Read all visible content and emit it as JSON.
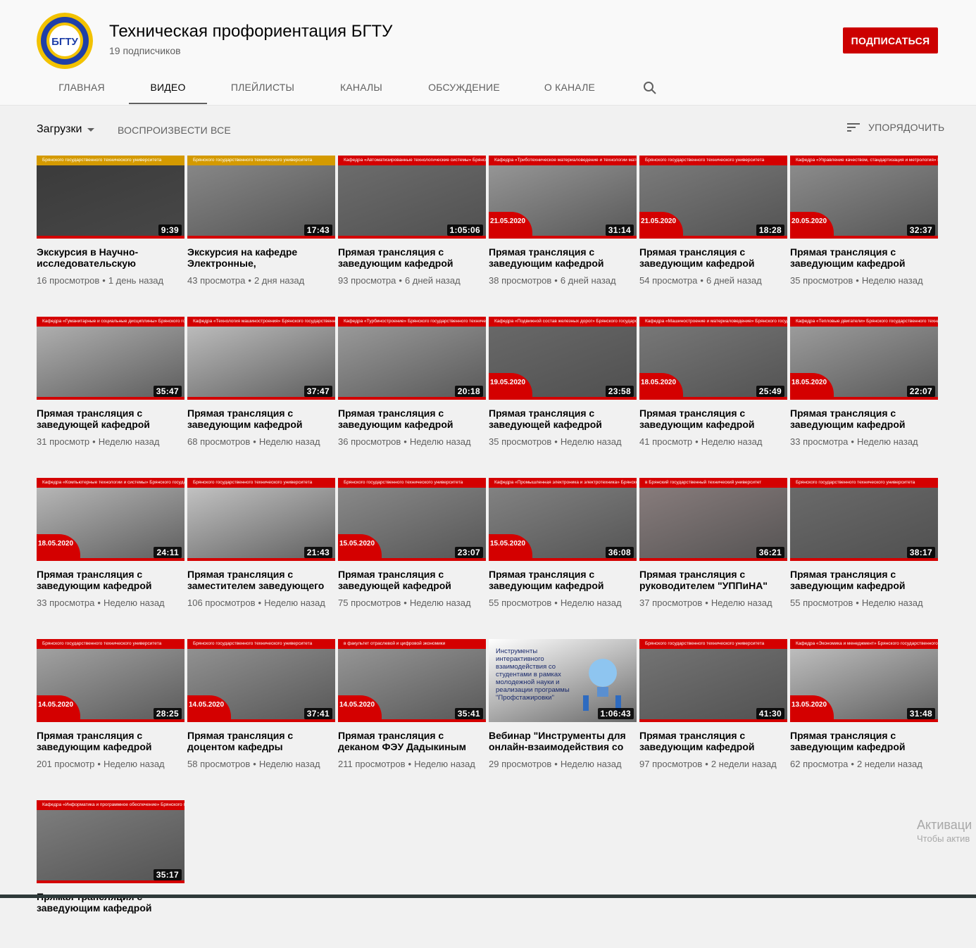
{
  "channel": {
    "title": "Техническая профориентация БГТУ",
    "subscribers": "19 подписчиков",
    "avatar_text": "БГТУ",
    "subscribe_label": "ПОДПИСАТЬСЯ"
  },
  "tabs": [
    {
      "label": "ГЛАВНАЯ"
    },
    {
      "label": "ВИДЕО"
    },
    {
      "label": "ПЛЕЙЛИСТЫ"
    },
    {
      "label": "КАНАЛЫ"
    },
    {
      "label": "ОБСУЖДЕНИЕ"
    },
    {
      "label": "О КАНАЛЕ"
    }
  ],
  "toolbar": {
    "uploads_label": "Загрузки",
    "play_all_label": "ВОСПРОИЗВЕСТИ ВСЕ",
    "sort_label": "УПОРЯДОЧИТЬ"
  },
  "colors": {
    "accent": "#cc0000",
    "text_secondary": "#606060",
    "page_bg": "#f1f1f1"
  },
  "videos": [
    {
      "title": "Экскурсия в Научно-исследовательскую лабораторию",
      "views": "16 просмотров",
      "age": "1 день назад",
      "duration": "9:39",
      "banner": "Брянского государственного технического университета",
      "banner_style": "yellow",
      "date": "",
      "scene": "#3a3a3a"
    },
    {
      "title": "Экскурсия на кафедре Электронные, радиоэлектронные и электротехнические системы",
      "views": "43 просмотра",
      "age": "2 дня назад",
      "duration": "17:43",
      "banner": "Брянского государственного технического университета",
      "banner_style": "yellow",
      "date": "",
      "scene": "#8a8a8a"
    },
    {
      "title": "Прямая трансляция с заведующим кафедрой «Автоматизированные технологические системы»",
      "views": "93 просмотра",
      "age": "6 дней назад",
      "duration": "1:05:06",
      "banner": "Кафедра «Автоматизированные технологические системы» Брянского государственного технического университета",
      "banner_style": "red",
      "date": "",
      "scene": "#6e6e6e"
    },
    {
      "title": "Прямая трансляция с заведующим кафедрой «Триботехническое материаловедение»",
      "views": "38 просмотров",
      "age": "6 дней назад",
      "duration": "31:14",
      "banner": "Кафедра «Триботехническое материаловедение и технологии материалов» Брянского государственного технического университета",
      "banner_style": "red",
      "date": "21.05.2020",
      "scene": "#9a9a9a"
    },
    {
      "title": "Прямая трансляция с заведующим кафедрой «Нефтегазовое дело»",
      "views": "54 просмотра",
      "age": "6 дней назад",
      "duration": "18:28",
      "banner": "Брянского государственного технического университета",
      "banner_style": "red",
      "date": "21.05.2020",
      "scene": "#7d7d7d"
    },
    {
      "title": "Прямая трансляция с заведующим кафедрой «Управление качеством»",
      "views": "35 просмотров",
      "age": "Неделю назад",
      "duration": "32:37",
      "banner": "Кафедра «Управление качеством, стандартизация и метрология» Брянского государственного технического университета",
      "banner_style": "red",
      "date": "20.05.2020",
      "scene": "#8f8f8f"
    },
    {
      "title": "Прямая трансляция с заведующей кафедрой «Гуманитарные и социальные дисциплины»",
      "views": "31 просмотр",
      "age": "Неделю назад",
      "duration": "35:47",
      "banner": "Кафедра «Гуманитарные и социальные дисциплины» Брянского государственного технического университета",
      "banner_style": "red",
      "date": "",
      "scene": "#b5b5b5"
    },
    {
      "title": "Прямая трансляция с заведующим кафедрой «Технология машиностроения»",
      "views": "68 просмотров",
      "age": "Неделю назад",
      "duration": "37:47",
      "banner": "Кафедра «Технология машиностроения» Брянского государственного технического университета",
      "banner_style": "red",
      "date": "",
      "scene": "#c2c2c2"
    },
    {
      "title": "Прямая трансляция с заведующим кафедрой «Турбиностроение»",
      "views": "36 просмотров",
      "age": "Неделю назад",
      "duration": "20:18",
      "banner": "Кафедра «Турбиностроение» Брянского государственного технического университета",
      "banner_style": "red",
      "date": "",
      "scene": "#9e9e9e"
    },
    {
      "title": "Прямая трансляция с заведующей кафедрой «Подвижной состав железных дорог»",
      "views": "35 просмотров",
      "age": "Неделю назад",
      "duration": "23:58",
      "banner": "Кафедра «Подвижной состав железных дорог» Брянского государственного технического университета",
      "banner_style": "red",
      "date": "19.05.2020",
      "scene": "#6a6a6a"
    },
    {
      "title": "Прямая трансляция с заведующим кафедрой «Машиностроение и материаловедение»",
      "views": "41 просмотр",
      "age": "Неделю назад",
      "duration": "25:49",
      "banner": "Кафедра «Машиностроение и материаловедение» Брянского государственного технического университета",
      "banner_style": "red",
      "date": "18.05.2020",
      "scene": "#7a7a7a"
    },
    {
      "title": "Прямая трансляция с заведующим кафедрой «Тепловые двигатели»",
      "views": "33 просмотра",
      "age": "Неделю назад",
      "duration": "22:07",
      "banner": "Кафедра «Тепловые двигатели» Брянского государственного технического университета",
      "banner_style": "red",
      "date": "18.05.2020",
      "scene": "#a0a0a0"
    },
    {
      "title": "Прямая трансляция с заведующим кафедрой «Компьютерные технологии и системы»",
      "views": "33 просмотра",
      "age": "Неделю назад",
      "duration": "24:11",
      "banner": "Кафедра «Компьютерные технологии и системы» Брянского государственного технического университета",
      "banner_style": "red",
      "date": "18.05.2020",
      "scene": "#bdbdbd"
    },
    {
      "title": "Прямая трансляция с заместителем заведующего кафедрой",
      "views": "106 просмотров",
      "age": "Неделю назад",
      "duration": "21:43",
      "banner": "Брянского государственного технического университета",
      "banner_style": "red",
      "date": "",
      "scene": "#c9c9c9"
    },
    {
      "title": "Прямая трансляция с заведующей кафедрой «Информатика и программное обеспечение»",
      "views": "75 просмотров",
      "age": "Неделю назад",
      "duration": "23:07",
      "banner": "Брянского государственного технического университета",
      "banner_style": "red",
      "date": "15.05.2020",
      "scene": "#8d8d8d"
    },
    {
      "title": "Прямая трансляция с заведующим кафедрой «Промышленная электроника и электротехника»",
      "views": "55 просмотров",
      "age": "Неделю назад",
      "duration": "36:08",
      "banner": "Кафедра «Промышленная электроника и электротехника» Брянского государственного технического университета",
      "banner_style": "red",
      "date": "15.05.2020",
      "scene": "#858585"
    },
    {
      "title": "Прямая трансляция с руководителем \"УППиНА\" Брянского государственного технического университета",
      "views": "37 просмотров",
      "age": "Неделю назад",
      "duration": "36:21",
      "banner": "в Брянский государственный технический университет",
      "banner_style": "red",
      "date": "",
      "scene": "#8b7f7f"
    },
    {
      "title": "Прямая трансляция с заведующим кафедрой «Металлорежущие станки и инструменты»",
      "views": "55 просмотров",
      "age": "Неделю назад",
      "duration": "38:17",
      "banner": "Брянского государственного технического университета",
      "banner_style": "red",
      "date": "",
      "scene": "#6c6c6c"
    },
    {
      "title": "Прямая трансляция с заведующим кафедрой «Подъемно-транспортные машины»",
      "views": "201 просмотр",
      "age": "Неделю назад",
      "duration": "28:25",
      "banner": "Брянского государственного технического университета",
      "banner_style": "red",
      "date": "14.05.2020",
      "scene": "#a7a7a7"
    },
    {
      "title": "Прямая трансляция с доцентом кафедры «Безопасность жизнедеятельности»",
      "views": "58 просмотров",
      "age": "Неделю назад",
      "duration": "37:41",
      "banner": "Брянского государственного технического университета",
      "banner_style": "red",
      "date": "14.05.2020",
      "scene": "#959595"
    },
    {
      "title": "Прямая трансляция с деканом ФЭУ Дадыкиным В.С.",
      "views": "211 просмотров",
      "age": "Неделю назад",
      "duration": "35:41",
      "banner": "в факультет отраслевой и цифровой экономики",
      "banner_style": "red",
      "date": "14.05.2020",
      "scene": "#9a9a9a"
    },
    {
      "title": "Вебинар \"Инструменты для онлайн-взаимодействия со студентами\"",
      "views": "29 просмотров",
      "age": "Неделю назад",
      "duration": "1:06:43",
      "banner": "",
      "banner_style": "webinar",
      "date": "",
      "scene": "#ffffff"
    },
    {
      "title": "Прямая трансляция с заведующим кафедрой «Логистика»",
      "views": "97 просмотров",
      "age": "2 недели назад",
      "duration": "41:30",
      "banner": "Брянского государственного технического университета",
      "banner_style": "red",
      "date": "",
      "scene": "#767676"
    },
    {
      "title": "Прямая трансляция с заведующим кафедрой «Экономика и менеджмент»",
      "views": "62 просмотра",
      "age": "2 недели назад",
      "duration": "31:48",
      "banner": "Кафедра «Экономика и менеджмент» Брянского государственного технического университета",
      "banner_style": "red",
      "date": "13.05.2020",
      "scene": "#c4c4c4"
    },
    {
      "title": "Прямая трансляция с заведующим кафедрой «Информатика и программное обеспечение»",
      "views": "",
      "age": "",
      "duration": "35:17",
      "banner": "Кафедра «Информатика и программное обеспечение» Брянского государственного технического университета",
      "banner_style": "red",
      "date": "",
      "scene": "#808080"
    }
  ],
  "webinar_thumb_text": "Инструменты интерактивного взаимодействия со студентами в рамках молодежной науки и реализации программы \"Профстажировки\"",
  "windows_watermark": {
    "line1": "Активаци",
    "line2": "Чтобы актив"
  }
}
